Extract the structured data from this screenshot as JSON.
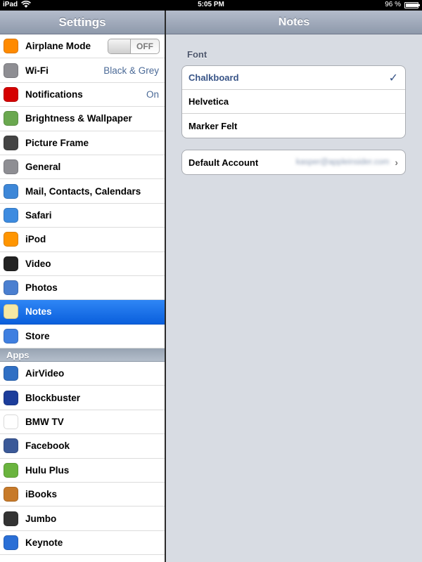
{
  "status_bar": {
    "carrier": "iPad",
    "time": "5:05 PM",
    "battery": "96 %",
    "battery_level": 0.96
  },
  "master": {
    "title": "Settings",
    "items": [
      {
        "label": "Airplane Mode",
        "icon": "airplane-icon",
        "icon_color": "#ff8a00",
        "toggle": "OFF"
      },
      {
        "label": "Wi-Fi",
        "icon": "wifi-icon",
        "icon_color": "#8e8e93",
        "value": "Black & Grey"
      },
      {
        "label": "Notifications",
        "icon": "notifications-icon",
        "icon_color": "#d50000",
        "value": "On"
      },
      {
        "label": "Brightness & Wallpaper",
        "icon": "flower-icon",
        "icon_color": "#6aa84f"
      },
      {
        "label": "Picture Frame",
        "icon": "picture-frame-icon",
        "icon_color": "#444444"
      },
      {
        "label": "General",
        "icon": "gear-icon",
        "icon_color": "#8e8e93"
      },
      {
        "label": "Mail, Contacts, Calendars",
        "icon": "mail-icon",
        "icon_color": "#3d87d8"
      },
      {
        "label": "Safari",
        "icon": "compass-icon",
        "icon_color": "#3d8be0"
      },
      {
        "label": "iPod",
        "icon": "ipod-icon",
        "icon_color": "#ff9500"
      },
      {
        "label": "Video",
        "icon": "clapper-icon",
        "icon_color": "#222222"
      },
      {
        "label": "Photos",
        "icon": "sunflower-icon",
        "icon_color": "#4a7fd0"
      },
      {
        "label": "Notes",
        "icon": "notepad-icon",
        "icon_color": "#f6e8a4",
        "selected": true
      },
      {
        "label": "Store",
        "icon": "store-icon",
        "icon_color": "#3f7fe0"
      }
    ],
    "apps_header": "Apps",
    "apps": [
      {
        "label": "AirVideo",
        "icon": "airvideo-icon",
        "icon_color": "#2f6fc4"
      },
      {
        "label": "Blockbuster",
        "icon": "blockbuster-icon",
        "icon_color": "#1c3d9b"
      },
      {
        "label": "BMW TV",
        "icon": "bmw-icon",
        "icon_color": "#ffffff"
      },
      {
        "label": "Facebook",
        "icon": "facebook-icon",
        "icon_color": "#3b5998"
      },
      {
        "label": "Hulu Plus",
        "icon": "hulu-icon",
        "icon_color": "#6ab43e"
      },
      {
        "label": "iBooks",
        "icon": "ibooks-icon",
        "icon_color": "#c77a2a"
      },
      {
        "label": "Jumbo",
        "icon": "jumbo-icon",
        "icon_color": "#333333"
      },
      {
        "label": "Keynote",
        "icon": "keynote-icon",
        "icon_color": "#2a6fd6"
      }
    ]
  },
  "detail": {
    "title": "Notes",
    "font_group_label": "Font",
    "fonts": [
      {
        "label": "Chalkboard",
        "selected": true
      },
      {
        "label": "Helvetica",
        "selected": false
      },
      {
        "label": "Marker Felt",
        "selected": false
      }
    ],
    "check_glyph": "✓",
    "default_account_label": "Default Account",
    "default_account_value": "kasper@appleinsider.com",
    "chevron_glyph": "›"
  }
}
